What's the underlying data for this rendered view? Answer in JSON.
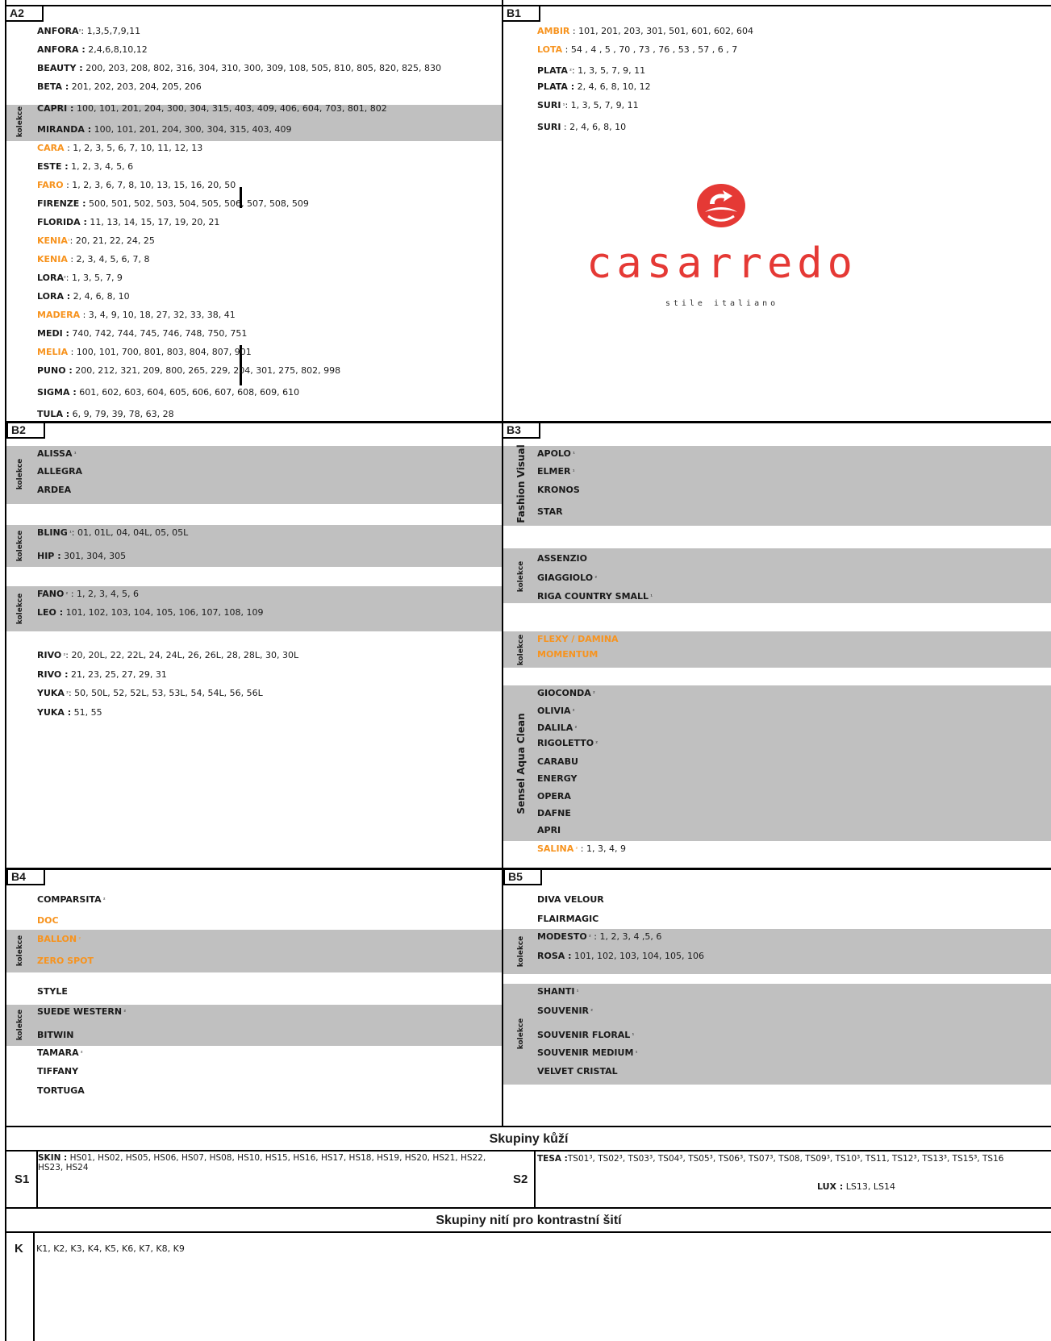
{
  "sections": {
    "A2": "A2",
    "B1": "B1",
    "B2": "B2",
    "B3": "B3",
    "B4": "B4",
    "B5": "B5"
  },
  "kolekce": "kolekce",
  "fashion_visual": "Fashion Visual",
  "sensel": "Sensel Aqua Clean",
  "a2": [
    {
      "name": "ANFORA",
      "sup": "²",
      "vals": ": 1,3,5,7,9,11",
      "orange": false
    },
    {
      "name": "ANFORA :",
      "sup": "",
      "vals": " 2,4,6,8,10,12",
      "orange": false
    },
    {
      "name": "BEAUTY :",
      "sup": "",
      "vals": " 200, 203, 208, 802, 316, 304, 310, 300, 309, 108, 505, 810, 805, 820, 825, 830",
      "orange": false
    },
    {
      "name": "BETA :",
      "sup": "",
      "vals": " 201, 202, 203, 204, 205, 206",
      "orange": false
    },
    {
      "name": "CAPRI :",
      "sup": "",
      "vals": " 100, 101, 201, 204, 300, 304, 315, 403, 409, 406, 604, 703, 801, 802",
      "orange": false
    },
    {
      "name": "MIRANDA :",
      "sup": "",
      "vals": " 100, 101, 201, 204, 300, 304, 315, 403, 409",
      "orange": false
    },
    {
      "name": "CARA",
      "sup": "",
      "vals": " : 1, 2, 3, 5, 6, 7, 10, 11, 12, 13",
      "orange": true
    },
    {
      "name": "ESTE :",
      "sup": "",
      "vals": " 1, 2, 3, 4, 5, 6",
      "orange": false
    },
    {
      "name": "FARO",
      "sup": "",
      "vals": " : 1, 2, 3, 6, 7, 8, 10, 13, 15, 16, 20, 50",
      "orange": true
    },
    {
      "name": "FIRENZE :",
      "sup": "",
      "vals": " 500, 501, 502, 503, 504, 505, 506, 507, 508, 509",
      "orange": false
    },
    {
      "name": "FLORIDA :",
      "sup": "",
      "vals": " 11, 13, 14, 15, 17, 19, 20, 21",
      "orange": false
    },
    {
      "name": "KENIA",
      "sup": "¹",
      "vals": ": 20, 21, 22, 24, 25",
      "orange": true
    },
    {
      "name": "KENIA",
      "sup": "",
      "vals": " : 2, 3, 4, 5, 6, 7, 8",
      "orange": true
    },
    {
      "name": "LORA",
      "sup": "²",
      "vals": ": 1, 3, 5, 7, 9",
      "orange": false
    },
    {
      "name": "LORA :",
      "sup": "",
      "vals": " 2, 4, 6, 8, 10",
      "orange": false
    },
    {
      "name": "MADERA",
      "sup": "",
      "vals": " : 3, 4, 9, 10, 18, 27, 32, 33, 38, 41",
      "orange": true
    },
    {
      "name": "MEDI :",
      "sup": "",
      "vals": " 740, 742, 744, 745, 746, 748, 750, 751",
      "orange": false
    },
    {
      "name": "MELIA",
      "sup": "",
      "vals": " : 100, 101, 700, 801, 803, 804, 807, 901",
      "orange": true
    },
    {
      "name": "PUNO :",
      "sup": "",
      "vals": " 200, 212, 321, 209, 800, 265, 229, 204, 301, 275, 802, 998",
      "orange": false
    },
    {
      "name": "SIGMA :",
      "sup": "",
      "vals": " 601, 602, 603, 604, 605, 606, 607, 608, 609, 610",
      "orange": false
    },
    {
      "name": "TULA :",
      "sup": "",
      "vals": " 6, 9, 79, 39, 78, 63, 28",
      "orange": false
    }
  ],
  "b1": [
    {
      "name": "AMBIR",
      "sup": "",
      "vals": " : 101, 201, 203, 301, 501, 601, 602, 604",
      "orange": true
    },
    {
      "name": "LOTA",
      "sup": "",
      "vals": " : 54 , 4 , 5 , 70 , 73 , 76 , 53 , 57 , 6 , 7",
      "orange": true
    },
    {
      "name": "PLATA",
      "sup": " ²",
      "vals": ": 1, 3, 5, 7, 9, 11",
      "orange": false
    },
    {
      "name": "PLATA :",
      "sup": "",
      "vals": " 2, 4, 6, 8, 10, 12",
      "orange": false
    },
    {
      "name": "SURI",
      "sup": " ¹",
      "vals": ": 1, 3, 5, 7, 9, 11",
      "orange": false
    },
    {
      "name": "SURI",
      "sup": "",
      "vals": " : 2, 4, 6, 8, 10",
      "orange": false
    }
  ],
  "logo": {
    "brand": "casarredo",
    "tagline": "stile italiano"
  },
  "b2": [
    {
      "name": "ALISSA",
      "sup": " ¹",
      "vals": "",
      "orange": false
    },
    {
      "name": "ALLEGRA",
      "sup": "",
      "vals": "",
      "orange": false
    },
    {
      "name": "ARDEA",
      "sup": "",
      "vals": "",
      "orange": false
    },
    {
      "name": "BLING",
      "sup": " ¹",
      "vals": ":  01, 01L, 04, 04L, 05, 05L",
      "orange": false
    },
    {
      "name": "HIP :",
      "sup": "",
      "vals": " 301, 304, 305",
      "orange": false
    },
    {
      "name": "FANO",
      "sup": " ²",
      "vals": " : 1, 2, 3, 4, 5, 6",
      "orange": false
    },
    {
      "name": "LEO :",
      "sup": "",
      "vals": " 101, 102, 103, 104, 105, 106, 107, 108, 109",
      "orange": false
    },
    {
      "name": "RIVO",
      "sup": " ²",
      "vals": ": 20, 20L, 22, 22L, 24, 24L, 26, 26L, 28, 28L, 30, 30L",
      "orange": false
    },
    {
      "name": "RIVO :",
      "sup": "",
      "vals": " 21, 23, 25, 27, 29, 31",
      "orange": false
    },
    {
      "name": "YUKA",
      "sup": " ²",
      "vals": ": 50, 50L, 52, 52L, 53, 53L, 54, 54L, 56, 56L",
      "orange": false
    },
    {
      "name": "YUKA :",
      "sup": "",
      "vals": " 51, 55",
      "orange": false
    }
  ],
  "b3": [
    {
      "name": "APOLO",
      "sup": " ¹",
      "vals": "",
      "orange": false
    },
    {
      "name": "ELMER",
      "sup": " ¹",
      "vals": "",
      "orange": false
    },
    {
      "name": "KRONOS",
      "sup": "",
      "vals": "",
      "orange": false
    },
    {
      "name": "STAR",
      "sup": "",
      "vals": "",
      "orange": false
    },
    {
      "name": "ASSENZIO",
      "sup": "",
      "vals": "",
      "orange": false
    },
    {
      "name": "GIAGGIOLO",
      "sup": " ²",
      "vals": "",
      "orange": false
    },
    {
      "name": "RIGA COUNTRY SMALL",
      "sup": " ¹",
      "vals": "",
      "orange": false
    },
    {
      "name": "FLEXY / DAMINA",
      "sup": "",
      "vals": "",
      "orange": true
    },
    {
      "name": "MOMENTUM",
      "sup": "",
      "vals": "",
      "orange": true
    },
    {
      "name": "GIOCONDA",
      "sup": " ²",
      "vals": "",
      "orange": false
    },
    {
      "name": "OLIVIA",
      "sup": " ²",
      "vals": "",
      "orange": false
    },
    {
      "name": "DALILA",
      "sup": " ²",
      "vals": "",
      "orange": false
    },
    {
      "name": "RIGOLETTO",
      "sup": " ²",
      "vals": "",
      "orange": false
    },
    {
      "name": "CARABU",
      "sup": "",
      "vals": "",
      "orange": false
    },
    {
      "name": "ENERGY",
      "sup": "",
      "vals": "",
      "orange": false
    },
    {
      "name": "OPERA",
      "sup": "",
      "vals": "",
      "orange": false
    },
    {
      "name": "DAFNE",
      "sup": "",
      "vals": "",
      "orange": false
    },
    {
      "name": "APRI",
      "sup": "",
      "vals": "",
      "orange": false
    },
    {
      "name": "SALINA",
      "sup": " ²",
      "vals": " : 1, 3, 4, 9",
      "orange": true
    }
  ],
  "b4": [
    {
      "name": "COMPARSITA",
      "sup": " ²",
      "vals": "",
      "orange": false
    },
    {
      "name": "DOC",
      "sup": "",
      "vals": "",
      "orange": true
    },
    {
      "name": "BALLON",
      "sup": " ²",
      "vals": "",
      "orange": true
    },
    {
      "name": "ZERO SPOT",
      "sup": "",
      "vals": "",
      "orange": true
    },
    {
      "name": "STYLE",
      "sup": "",
      "vals": "",
      "orange": false
    },
    {
      "name": "SUEDE WESTERN",
      "sup": " ²",
      "vals": "",
      "orange": false
    },
    {
      "name": "BITWIN",
      "sup": "",
      "vals": "",
      "orange": false
    },
    {
      "name": "TAMARA",
      "sup": " ²",
      "vals": "",
      "orange": false
    },
    {
      "name": "TIFFANY",
      "sup": "",
      "vals": "",
      "orange": false
    },
    {
      "name": "TORTUGA",
      "sup": "",
      "vals": "",
      "orange": false
    }
  ],
  "b5": [
    {
      "name": "DIVA VELOUR",
      "sup": "",
      "vals": "",
      "orange": false
    },
    {
      "name": "FLAIRMAGIC",
      "sup": "",
      "vals": "",
      "orange": false
    },
    {
      "name": "MODESTO",
      "sup": " ²",
      "vals": " : 1, 2, 3, 4 ,5, 6",
      "orange": false
    },
    {
      "name": "ROSA :",
      "sup": "",
      "vals": " 101, 102, 103, 104, 105, 106",
      "orange": false
    },
    {
      "name": "SHANTI",
      "sup": " ¹",
      "vals": "",
      "orange": false
    },
    {
      "name": "SOUVENIR",
      "sup": " ²",
      "vals": "",
      "orange": false
    },
    {
      "name": "SOUVENIR FLORAL",
      "sup": " ¹",
      "vals": "",
      "orange": false
    },
    {
      "name": "SOUVENIR MEDIUM",
      "sup": " ¹",
      "vals": "",
      "orange": false
    },
    {
      "name": "VELVET CRISTAL",
      "sup": "",
      "vals": "",
      "orange": false
    }
  ],
  "leather": {
    "title": "Skupiny kůží",
    "s1": "S1",
    "s2": "S2",
    "skin_name": "SKIN :",
    "skin_vals": " HS01, HS02, HS05, HS06, HS07, HS08, HS10, HS15, HS16, HS17, HS18, HS19, HS20, HS21, HS22, HS23, HS24",
    "tesa_name": "TESA :",
    "tesa_vals": "TS01³, TS02³, TS03³, TS04³, TS05³, TS06³, TS07³, TS08, TS09³, TS10³, TS11, TS12³, TS13³, TS15³, TS16",
    "lux_name": "LUX :",
    "lux_vals": "  LS13,  LS14"
  },
  "threads": {
    "title": "Skupiny nití pro kontrastní šití",
    "k": "K",
    "vals": "K1, K2, K3, K4, K5, K6, K7, K8, K9"
  }
}
